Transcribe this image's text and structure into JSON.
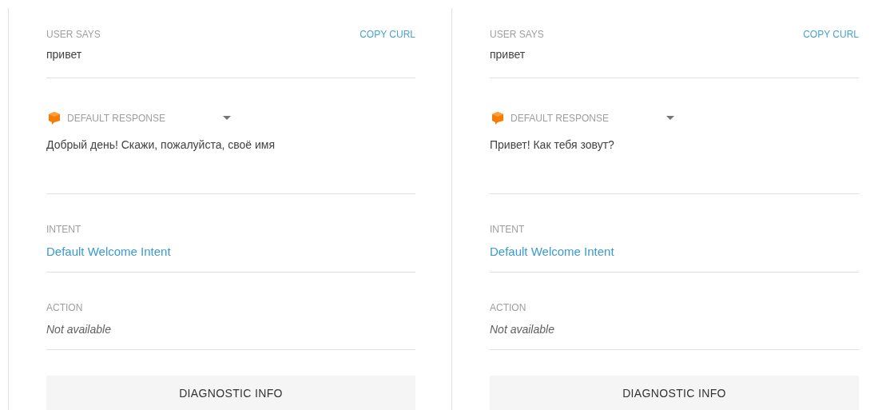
{
  "panels": [
    {
      "user_says": {
        "label": "USER SAYS",
        "text": "привет"
      },
      "copy_curl": "COPY CURL",
      "response": {
        "label": "DEFAULT RESPONSE",
        "text": "Добрый день! Скажи, пожалуйста, своё имя"
      },
      "intent": {
        "label": "INTENT",
        "text": "Default Welcome Intent"
      },
      "action": {
        "label": "ACTION",
        "text": "Not available"
      },
      "diagnostic_button": "DIAGNOSTIC INFO"
    },
    {
      "user_says": {
        "label": "USER SAYS",
        "text": "привет"
      },
      "copy_curl": "COPY CURL",
      "response": {
        "label": "DEFAULT RESPONSE",
        "text": "Привет! Как тебя зовут?"
      },
      "intent": {
        "label": "INTENT",
        "text": "Default Welcome Intent"
      },
      "action": {
        "label": "ACTION",
        "text": "Not available"
      },
      "diagnostic_button": "DIAGNOSTIC INFO"
    }
  ]
}
